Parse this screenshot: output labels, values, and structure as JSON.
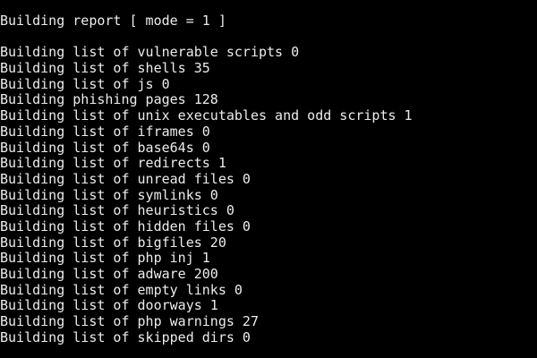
{
  "terminal": {
    "background_color": "#000000",
    "text_color": "#ececec",
    "header": "Building report [ mode = 1 ]",
    "lines": [
      "Building list of vulnerable scripts 0",
      "Building list of shells 35",
      "Building list of js 0",
      "Building phishing pages 128",
      "Building list of unix executables and odd scripts 1",
      "Building list of iframes 0",
      "Building list of base64s 0",
      "Building list of redirects 1",
      "Building list of unread files 0",
      "Building list of symlinks 0",
      "Building list of heuristics 0",
      "Building list of hidden files 0",
      "Building list of bigfiles 20",
      "Building list of php inj 1",
      "Building list of adware 200",
      "Building list of empty links 0",
      "Building list of doorways 1",
      "Building list of php warnings 27",
      "Building list of skipped dirs 0"
    ]
  }
}
